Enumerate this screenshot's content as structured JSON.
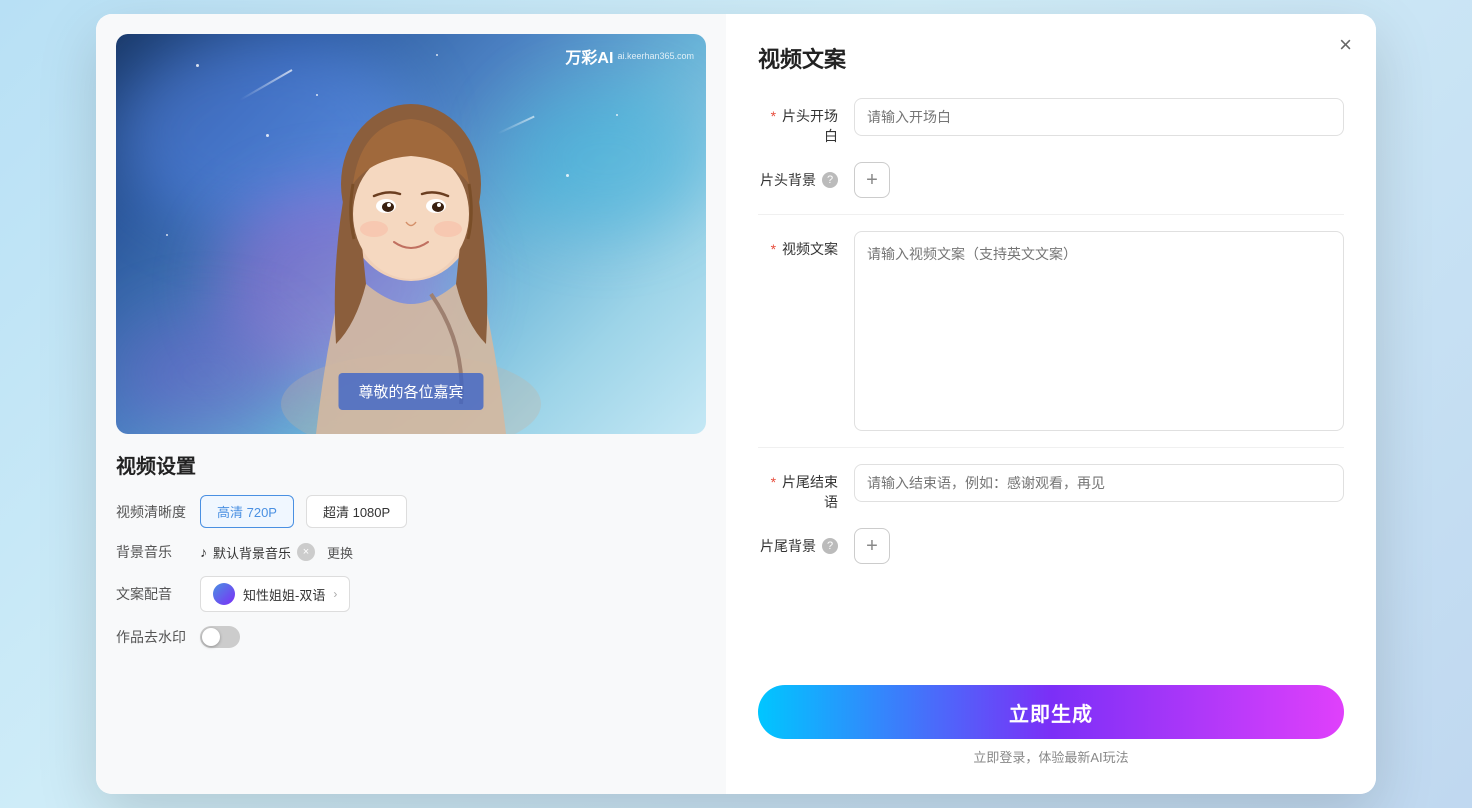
{
  "modal": {
    "close_label": "×",
    "left": {
      "video_settings_title": "视频设置",
      "video_quality_label": "视频清晰度",
      "quality_options": [
        {
          "label": "高清 720P",
          "active": true
        },
        {
          "label": "超清 1080P",
          "active": false
        }
      ],
      "bg_music_label": "背景音乐",
      "music_name": "默认背景音乐",
      "music_change": "更换",
      "voice_label": "文案配音",
      "voice_name": "知性姐姐-双语",
      "watermark_label": "作品去水印",
      "watermark_toggle": false,
      "subtitle_text": "尊敬的各位嘉宾",
      "watermark_brand": "万彩AI",
      "watermark_site": "ai.keerhan365.com"
    },
    "right": {
      "title": "视频文案",
      "opening_label": "片头开场白",
      "opening_placeholder": "请输入开场白",
      "opening_required": true,
      "bg_label": "片头背景",
      "bg_help": true,
      "video_copy_label": "视频文案",
      "video_copy_placeholder": "请输入视频文案（支持英文文案）",
      "video_copy_required": true,
      "ending_label": "片尾结束语",
      "ending_placeholder": "请输入结束语，例如：感谢观看，再见",
      "ending_required": true,
      "ending_bg_label": "片尾背景",
      "ending_bg_help": true,
      "generate_btn": "立即生成",
      "generate_hint_prefix": "立即登录，体验最新AI玩法",
      "generate_hint_link": ""
    }
  }
}
